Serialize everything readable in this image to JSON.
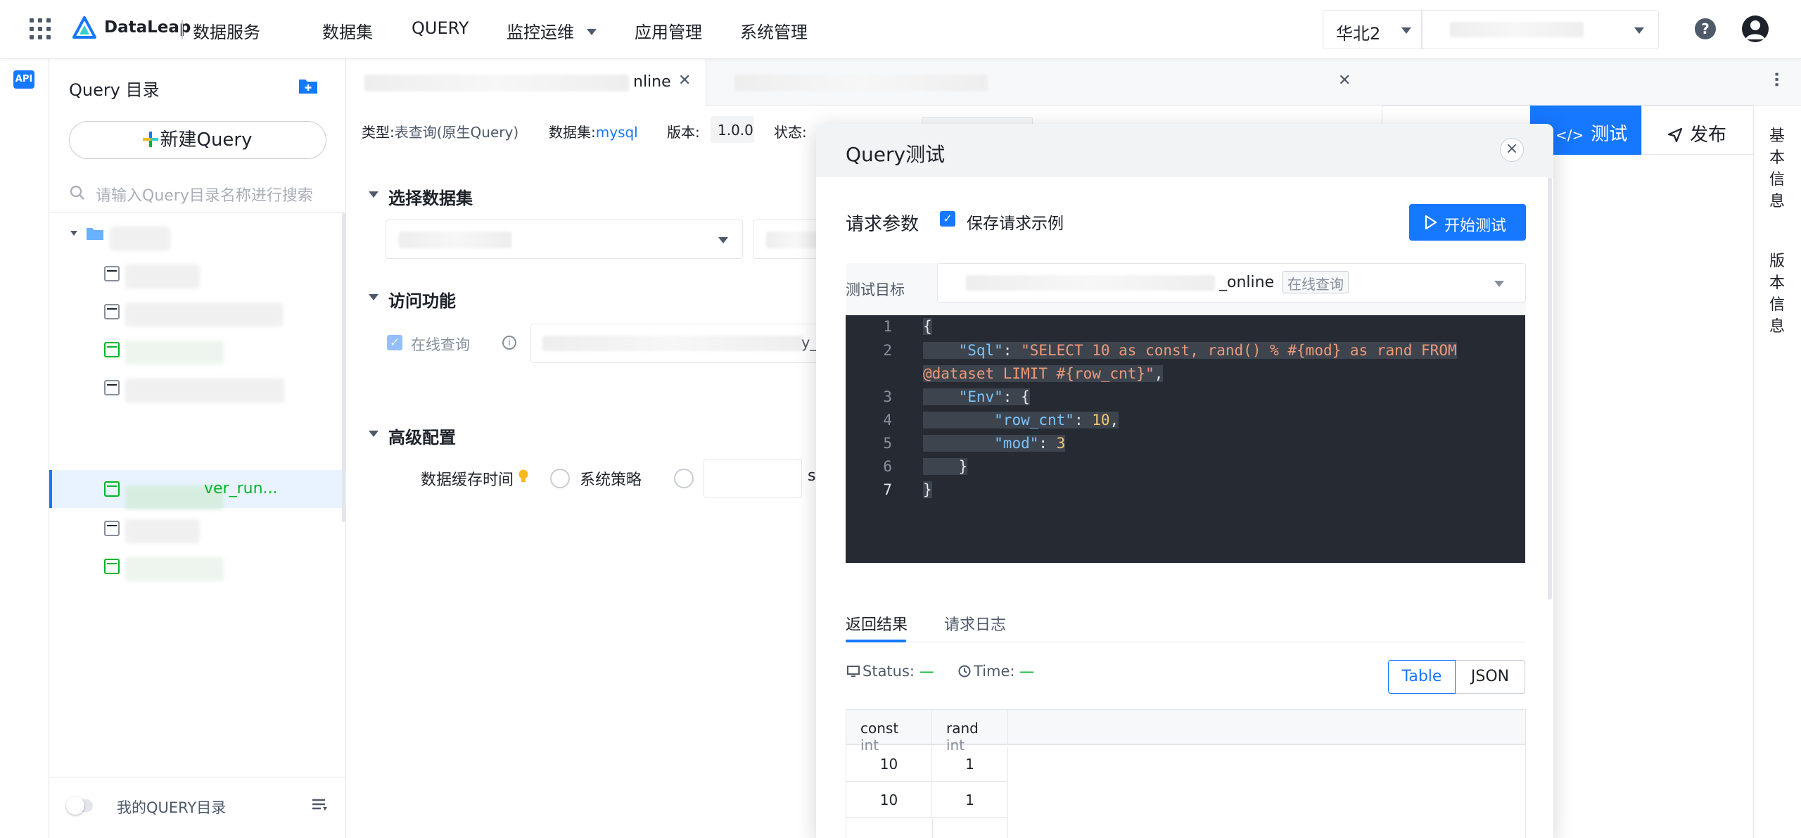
{
  "header": {
    "brand": "DataLeap",
    "subtitle": "数据服务",
    "nav": [
      "数据集",
      "QUERY",
      "监控运维",
      "应用管理",
      "系统管理"
    ],
    "region": "华北2",
    "help": "?"
  },
  "rail": {
    "api_label": "API"
  },
  "sidebar": {
    "title": "Query 目录",
    "new_query": "新建Query",
    "search_placeholder": "请输入Query目录名称进行搜索",
    "selected_item": "ver_run...",
    "my_dir": "我的QUERY目录"
  },
  "tabs": {
    "active_suffix": "nline"
  },
  "meta": {
    "type_label": "类型:",
    "type_value": "表查询(原生Query)",
    "dataset_label": "数据集:",
    "dataset_value": "mysql",
    "version_label": "版本:",
    "version_value": "1.0.0",
    "state_label": "状态:"
  },
  "actions": {
    "test": "测试",
    "publish": "发布"
  },
  "right_rail": {
    "basic": "基本信息",
    "version": "版本信息"
  },
  "sections": {
    "dataset": "选择数据集",
    "access": "访问功能",
    "online_query": "在线查询",
    "online_suffix": "y_",
    "advanced": "高级配置",
    "cache_label": "数据缓存时间",
    "system_policy": "系统策略",
    "seconds_unit": "s"
  },
  "modal": {
    "title": "Query测试",
    "close": "×",
    "req_params": "请求参数",
    "save_example": "保存请求示例",
    "start_test": "开始测试",
    "target_label": "测试目标",
    "target_name": "_online",
    "target_tag": "在线查询",
    "editor_lines": [
      "1",
      "2",
      "3",
      "4",
      "5",
      "6",
      "7"
    ],
    "code": {
      "l1": "{",
      "sql_key": "\"Sql\"",
      "sql_val_a": "\"SELECT 10 as const, rand() % #{mod} as rand FROM",
      "sql_val_b": "@dataset LIMIT #{row_cnt}\"",
      "env_key": "\"Env\"",
      "row_key": "\"row_cnt\"",
      "row_val": "10",
      "mod_key": "\"mod\"",
      "mod_val": "3",
      "l6": "}",
      "l7": "}"
    },
    "result_tabs": [
      "返回结果",
      "请求日志"
    ],
    "status_label": "Status:",
    "time_label": "Time:",
    "dash": "—",
    "view_modes": [
      "Table",
      "JSON"
    ],
    "columns": [
      {
        "name": "const",
        "type": "int"
      },
      {
        "name": "rand",
        "type": "int"
      }
    ],
    "rows": [
      [
        "10",
        "1"
      ],
      [
        "10",
        "1"
      ]
    ]
  },
  "colors": {
    "primary": "#1677ff",
    "success": "#00b42a",
    "editor_bg": "#262b33"
  }
}
